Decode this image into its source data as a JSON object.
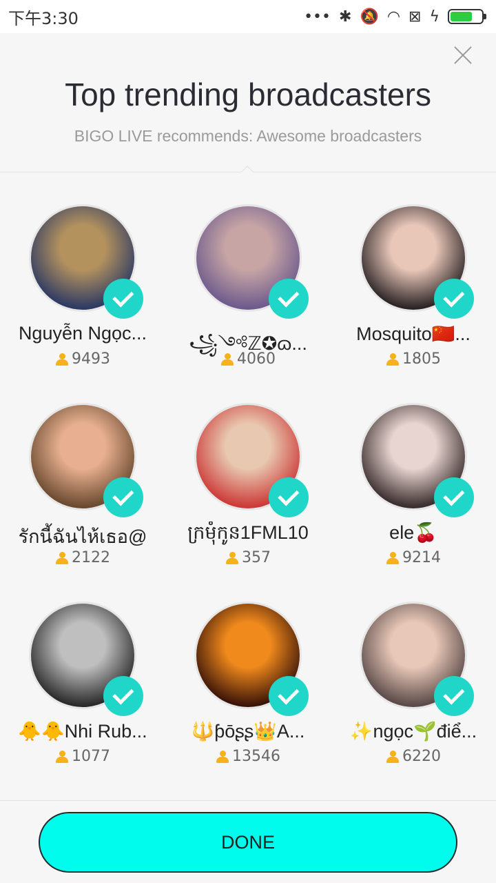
{
  "status_bar": {
    "time": "下午3:30",
    "icons": [
      "dots-icon",
      "bluetooth-icon",
      "mute-icon",
      "wifi-icon",
      "sim-icon",
      "charging-icon",
      "battery-icon"
    ]
  },
  "header": {
    "title": "Top trending broadcasters",
    "subtitle": "BIGO LIVE recommends: Awesome broadcasters"
  },
  "broadcasters": [
    {
      "name": "Nguyễn Ngọc...",
      "followers": "9493",
      "colors": [
        "#2d3a63",
        "#b4925e"
      ]
    },
    {
      "name": "꧁༺ℤ✪ɷ...",
      "followers": "4060",
      "colors": [
        "#6e5b8d",
        "#c7a5a5"
      ]
    },
    {
      "name": "Mosquito🇨🇳...",
      "followers": "1805",
      "colors": [
        "#2b2426",
        "#e8c6b8"
      ]
    },
    {
      "name": "รักนี้ฉันไห้เธอ@",
      "followers": "2122",
      "colors": [
        "#6b4a30",
        "#e8b090"
      ]
    },
    {
      "name": "ក្រមុំកូន1FML10",
      "followers": "357",
      "colors": [
        "#cc3a38",
        "#e8c8b0"
      ]
    },
    {
      "name": "ele🍒",
      "followers": "9214",
      "colors": [
        "#3a2e2e",
        "#e8d4d0"
      ]
    },
    {
      "name": "🐥🐥Nhi Rub...",
      "followers": "1077",
      "colors": [
        "#2a2a2a",
        "#bfbfbf"
      ]
    },
    {
      "name": "🔱ƥōʂʂ👑A...",
      "followers": "13546",
      "colors": [
        "#3b1408",
        "#f08a1c"
      ]
    },
    {
      "name": "✨ngọc🌱điể...",
      "followers": "6220",
      "colors": [
        "#5a4a48",
        "#e8c8b8"
      ]
    }
  ],
  "footer": {
    "done_label": "DONE"
  },
  "colors": {
    "accent": "#00fcec",
    "badge": "#20d6c8",
    "follower_icon": "#f6b21b"
  }
}
